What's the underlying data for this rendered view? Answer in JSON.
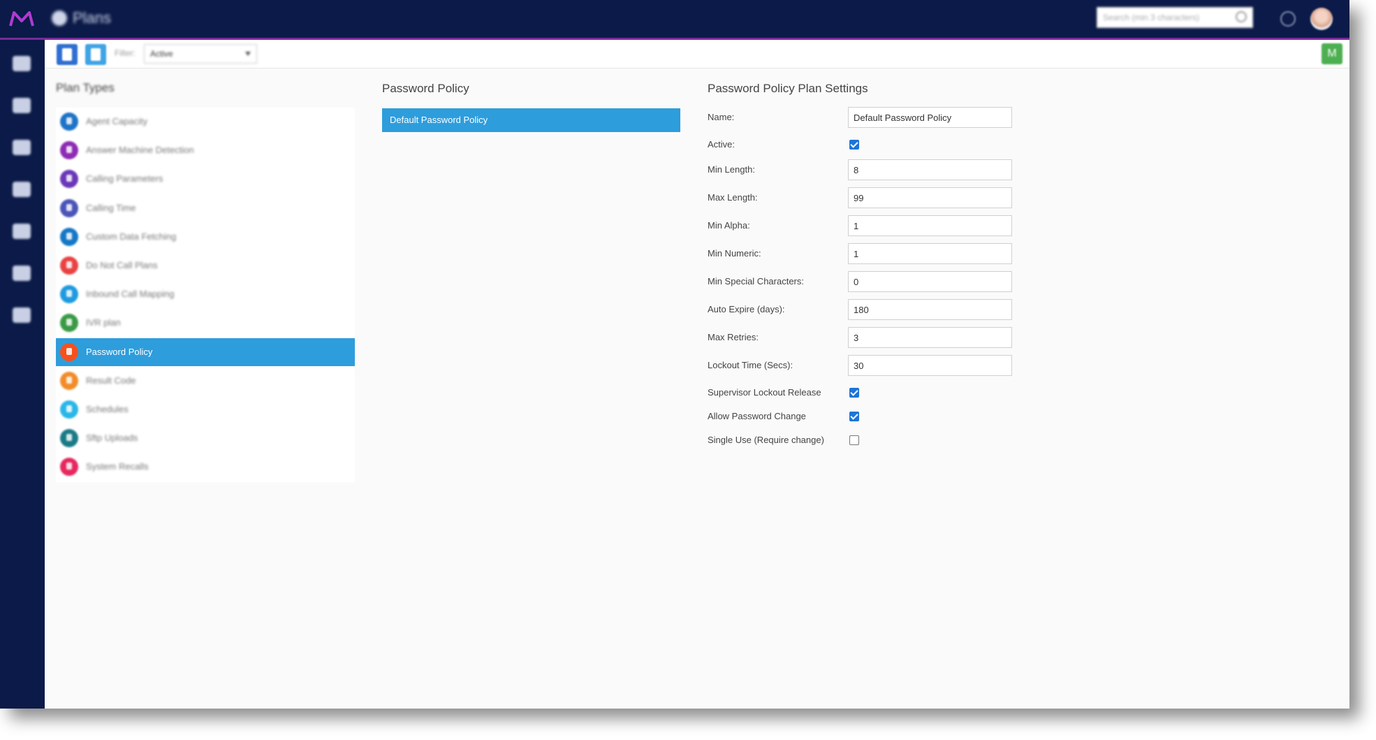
{
  "header": {
    "app_title": "Plans",
    "search_placeholder": "Search (min 3 characters)"
  },
  "sidebar": {
    "icons": [
      "home-icon",
      "dashboard-icon",
      "gauge-icon",
      "database-icon",
      "export-icon",
      "document-icon",
      "settings-icon"
    ]
  },
  "toolbar": {
    "filter_label": "Filter:",
    "filter_value": "Active",
    "right_button_label": "M"
  },
  "plan_types": {
    "title": "Plan Types",
    "items": [
      {
        "label": "Agent Capacity",
        "color": "#1e73c8"
      },
      {
        "label": "Answer Machine Detection",
        "color": "#8e2bb5"
      },
      {
        "label": "Calling Parameters",
        "color": "#6a37b8"
      },
      {
        "label": "Calling Time",
        "color": "#4a55b8"
      },
      {
        "label": "Custom Data Fetching",
        "color": "#1578c7"
      },
      {
        "label": "Do Not Call Plans",
        "color": "#e94242"
      },
      {
        "label": "Inbound Call Mapping",
        "color": "#1e9be0"
      },
      {
        "label": "IVR plan",
        "color": "#3a9a45"
      },
      {
        "label": "Password Policy",
        "color": "#f4511e"
      },
      {
        "label": "Result Code",
        "color": "#f28c28"
      },
      {
        "label": "Schedules",
        "color": "#29b6e8"
      },
      {
        "label": "Sftp Uploads",
        "color": "#1a7b86"
      },
      {
        "label": "System Recalls",
        "color": "#e6285e"
      }
    ],
    "active_index": 8
  },
  "policy_list": {
    "title": "Password Policy",
    "items": [
      "Default Password Policy"
    ]
  },
  "settings": {
    "title": "Password Policy Plan Settings",
    "name_label": "Name:",
    "name_value": "Default Password Policy",
    "active_label": "Active:",
    "active_checked": true,
    "min_length_label": "Min Length:",
    "min_length_value": "8",
    "max_length_label": "Max Length:",
    "max_length_value": "99",
    "min_alpha_label": "Min Alpha:",
    "min_alpha_value": "1",
    "min_numeric_label": "Min Numeric:",
    "min_numeric_value": "1",
    "min_special_label": "Min Special Characters:",
    "min_special_value": "0",
    "auto_expire_label": "Auto Expire (days):",
    "auto_expire_value": "180",
    "max_retries_label": "Max Retries:",
    "max_retries_value": "3",
    "lockout_time_label": "Lockout Time (Secs):",
    "lockout_time_value": "30",
    "supervisor_release_label": "Supervisor Lockout Release",
    "supervisor_release_checked": true,
    "allow_change_label": "Allow Password Change",
    "allow_change_checked": true,
    "single_use_label": "Single Use (Require change)",
    "single_use_checked": false
  }
}
